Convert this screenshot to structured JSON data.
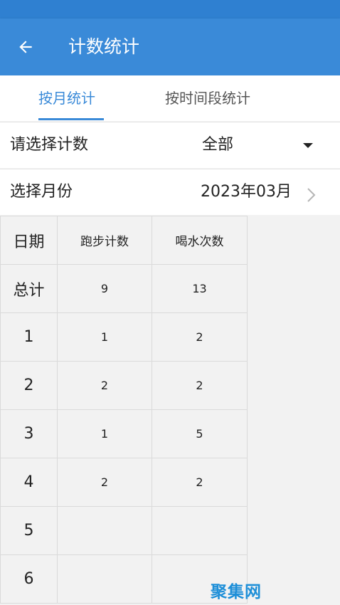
{
  "app_bar": {
    "title": "计数统计"
  },
  "tabs": [
    {
      "label": "按月统计",
      "active": true
    },
    {
      "label": "按时间段统计",
      "active": false
    }
  ],
  "filters": {
    "type_label": "请选择计数",
    "type_value": "全部",
    "month_label": "选择月份",
    "month_value": "2023年03月"
  },
  "table": {
    "headers": [
      "日期",
      "跑步计数",
      "喝水次数"
    ],
    "rows": [
      [
        "总计",
        "9",
        "13"
      ],
      [
        "1",
        "1",
        "2"
      ],
      [
        "2",
        "2",
        "2"
      ],
      [
        "3",
        "1",
        "5"
      ],
      [
        "4",
        "2",
        "2"
      ],
      [
        "5",
        "",
        ""
      ],
      [
        "6",
        "",
        ""
      ]
    ]
  },
  "watermark": "聚集网",
  "colors": {
    "primary": "#3a8ad8",
    "status_bar": "#2f80d1",
    "watermark": "#1e8fd8"
  }
}
